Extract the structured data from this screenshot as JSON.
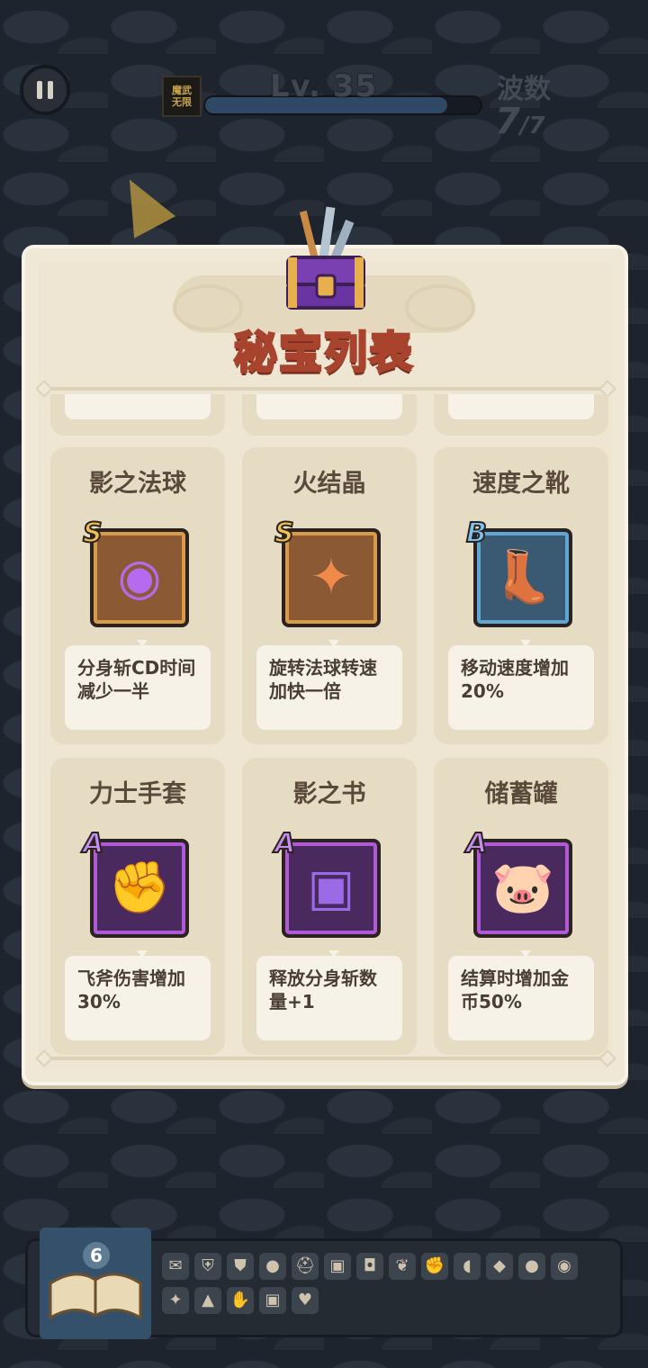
{
  "hud": {
    "avatar_text": "魔武\n无限",
    "level_label": "Lv. 35",
    "xp_progress": 0.88,
    "wave_label": "波数",
    "wave_current": "7",
    "wave_total": "/7"
  },
  "panel": {
    "title": "秘宝列表"
  },
  "treasures": [
    {
      "name": "影之法球",
      "rank": "S",
      "desc": "分身斩CD时间减少一半",
      "icon": "purple-eye-orb-icon",
      "glyph": "◉",
      "color": "#b66af0"
    },
    {
      "name": "火结晶",
      "rank": "S",
      "desc": "旋转法球转速加快一倍",
      "icon": "fire-crystal-icon",
      "glyph": "✦",
      "color": "#f08a4a"
    },
    {
      "name": "速度之靴",
      "rank": "B",
      "desc": "移动速度增加20%",
      "icon": "winged-boot-icon",
      "glyph": "👢",
      "color": "#b8733a"
    },
    {
      "name": "力士手套",
      "rank": "A",
      "desc": "飞斧伤害增加30%",
      "icon": "gauntlet-icon",
      "glyph": "✊",
      "color": "#cfcfcf"
    },
    {
      "name": "影之书",
      "rank": "A",
      "desc": "释放分身斩数量+1",
      "icon": "shadow-book-icon",
      "glyph": "▣",
      "color": "#9b6ae6"
    },
    {
      "name": "储蓄罐",
      "rank": "A",
      "desc": "结算时增加金币50%",
      "icon": "piggy-bank-icon",
      "glyph": "🐷",
      "color": "#f4a3c0"
    }
  ],
  "bottom_bar": {
    "book_count": "6",
    "mini_icons": [
      "scroll",
      "armor",
      "shield",
      "bomb",
      "helmet",
      "book",
      "bag",
      "leaf",
      "gauntlet",
      "cannon",
      "gem",
      "bomb2",
      "eye-orb",
      "crystal",
      "boot",
      "glove",
      "book2",
      "piggy"
    ]
  }
}
